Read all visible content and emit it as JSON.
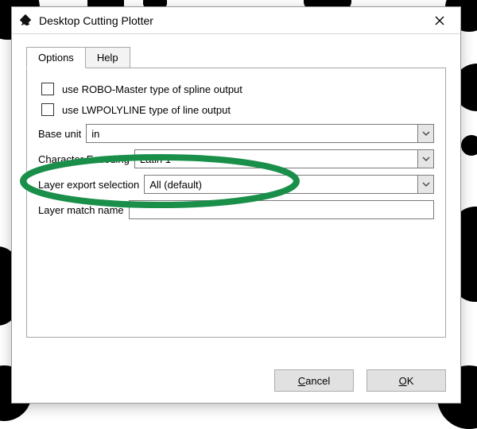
{
  "window": {
    "title": "Desktop Cutting Plotter",
    "icon": "inkscape-icon",
    "close_label": "Close"
  },
  "tabs": {
    "options": "Options",
    "help": "Help",
    "active": "Options"
  },
  "options": {
    "robo_label": "use ROBO-Master type of spline output",
    "robo_checked": false,
    "lwpoly_label": "use LWPOLYLINE type of line output",
    "lwpoly_checked": false,
    "base_unit_label": "Base unit",
    "base_unit_value": "in",
    "encoding_label": "Character Encoding",
    "encoding_value": "Latin 1",
    "layer_export_label": "Layer export selection",
    "layer_export_value": "All (default)",
    "layer_match_label": "Layer match name",
    "layer_match_value": ""
  },
  "buttons": {
    "cancel": "Cancel",
    "cancel_mnemonic": "C",
    "ok": "OK",
    "ok_mnemonic": "O"
  },
  "annotation": {
    "target": "base-unit-row",
    "color": "#1a8f4a"
  }
}
